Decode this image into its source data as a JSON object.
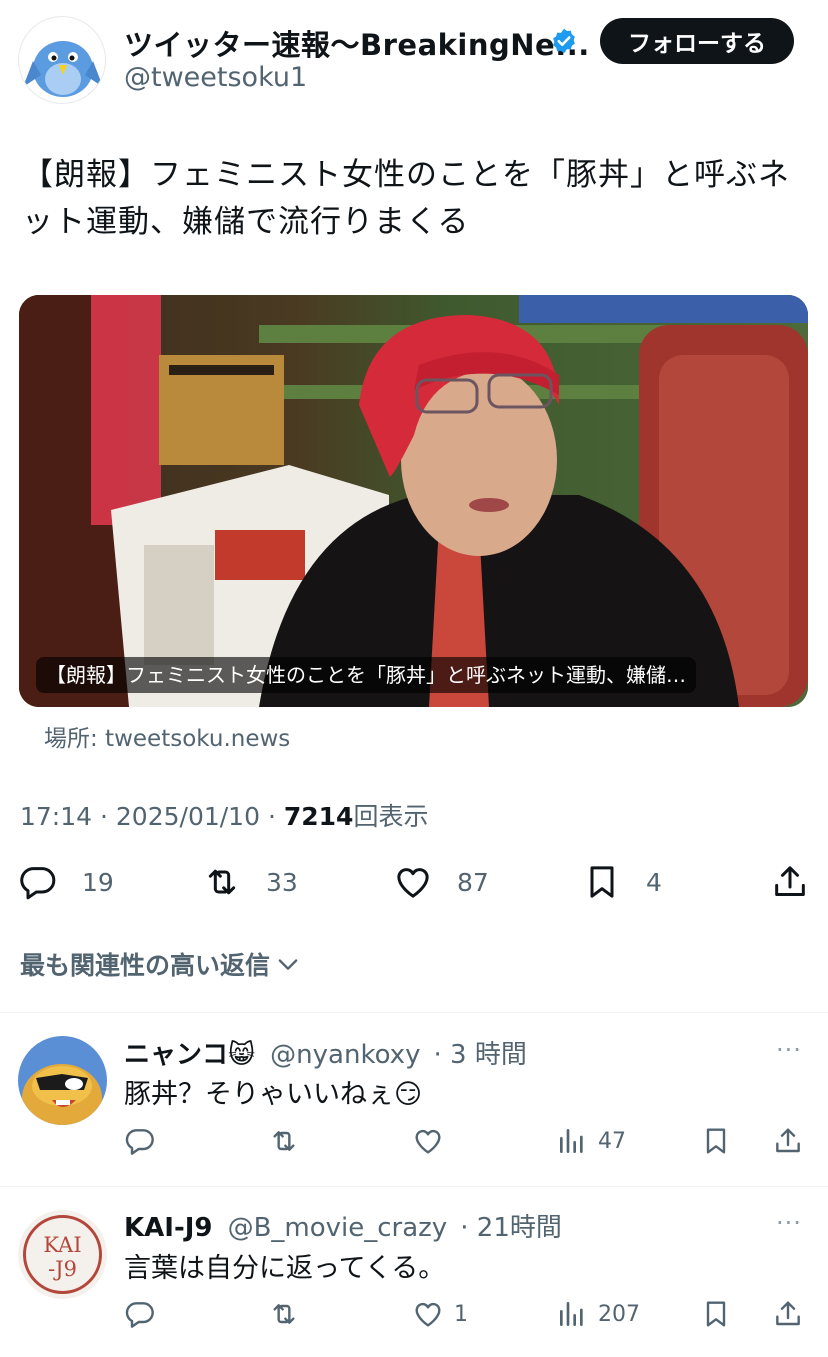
{
  "post": {
    "display_name": "ツイッター速報〜BreakingNe...",
    "handle": "@tweetsoku1",
    "follow_label": "フォローする",
    "text": "【朗報】フェミニスト女性のことを「豚丼」と呼ぶネット運動、嫌儲で流行りまくる",
    "card_caption": "【朗報】フェミニスト女性のことを「豚丼」と呼ぶネット運動、嫌儲…",
    "card_source": "場所: tweetsoku.news",
    "time": "17:14",
    "date": "2025/01/10",
    "views_count": "7214",
    "views_label": "回表示",
    "sep": "·",
    "stats": {
      "replies": "19",
      "retweets": "33",
      "likes": "87",
      "bookmarks": "4"
    }
  },
  "sort": {
    "label": "最も関連性の高い返信"
  },
  "replies": [
    {
      "name": "ニャンコ😸",
      "handle": "@nyankoxy",
      "time": "· 3 時間",
      "text": "豚丼？そりゃいいねぇ😏",
      "likes": "",
      "views": "47",
      "more": "···"
    },
    {
      "name": "KAI-J9",
      "handle": "@B_movie_crazy",
      "time": "· 21時間",
      "text": "言葉は自分に返ってくる。",
      "likes": "1",
      "views": "207",
      "more": "···",
      "avatar_text": [
        "KAI",
        "-J9"
      ]
    }
  ],
  "colors": {
    "accent": "#0f1419",
    "secondary": "#536471",
    "verified": "#1d9bf0"
  }
}
